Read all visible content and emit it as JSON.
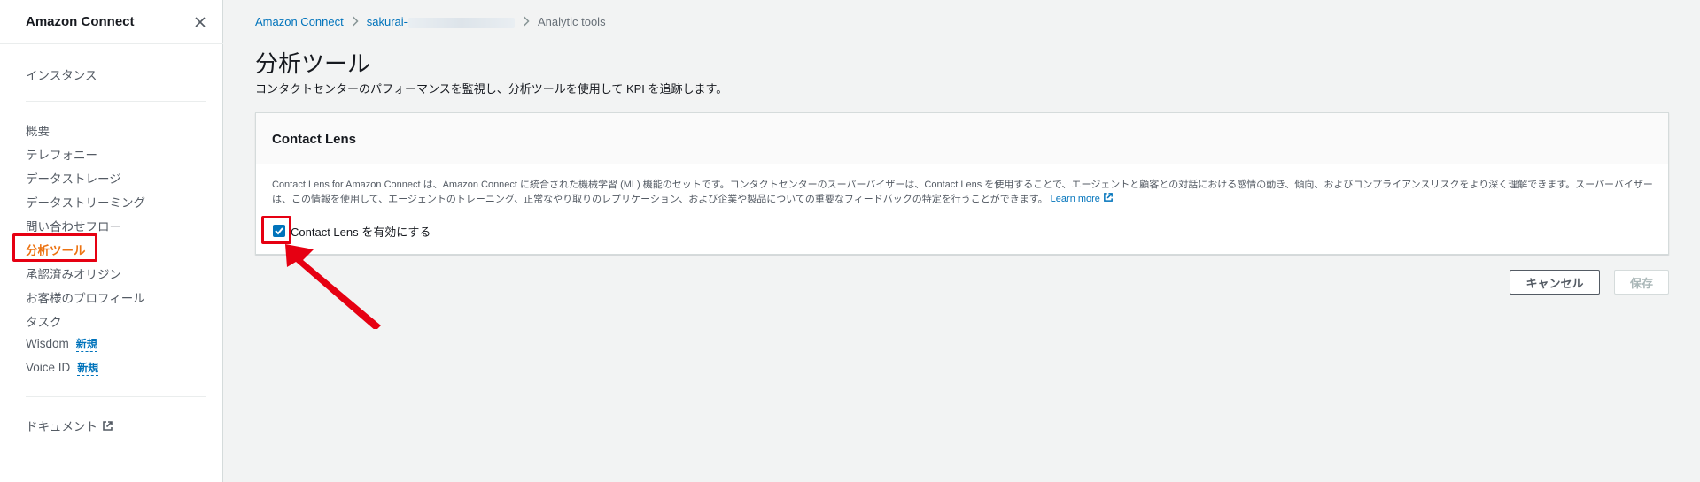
{
  "sidebar": {
    "title": "Amazon Connect",
    "top_item": "インスタンス",
    "items": [
      {
        "label": "概要"
      },
      {
        "label": "テレフォニー"
      },
      {
        "label": "データストレージ"
      },
      {
        "label": "データストリーミング"
      },
      {
        "label": "問い合わせフロー"
      },
      {
        "label": "分析ツール",
        "active": true
      },
      {
        "label": "承認済みオリジン"
      },
      {
        "label": "お客様のプロフィール"
      },
      {
        "label": "タスク"
      },
      {
        "label": "Wisdom",
        "badge": "新規"
      },
      {
        "label": "Voice ID",
        "badge": "新規"
      }
    ],
    "docs": "ドキュメント"
  },
  "breadcrumb": {
    "root": "Amazon Connect",
    "instance": "sakurai-",
    "current": "Analytic tools"
  },
  "page": {
    "title": "分析ツール",
    "description": "コンタクトセンターのパフォーマンスを監視し、分析ツールを使用して KPI を追跡します。"
  },
  "panel": {
    "title": "Contact Lens",
    "description": "Contact Lens for Amazon Connect は、Amazon Connect に統合された機械学習 (ML) 機能のセットです。コンタクトセンターのスーパーバイザーは、Contact Lens を使用することで、エージェントと顧客との対話における感情の動き、傾向、およびコンプライアンスリスクをより深く理解できます。スーパーバイザーは、この情報を使用して、エージェントのトレーニング、正常なやり取りのレプリケーション、および企業や製品についての重要なフィードバックの特定を行うことができます。",
    "learn_more": "Learn more",
    "checkbox_label": "Contact Lens を有効にする",
    "checkbox_checked": true
  },
  "buttons": {
    "cancel": "キャンセル",
    "save": "保存"
  },
  "colors": {
    "accent": "#0073bb",
    "active_nav": "#ec7211",
    "annotation": "#e60012"
  }
}
